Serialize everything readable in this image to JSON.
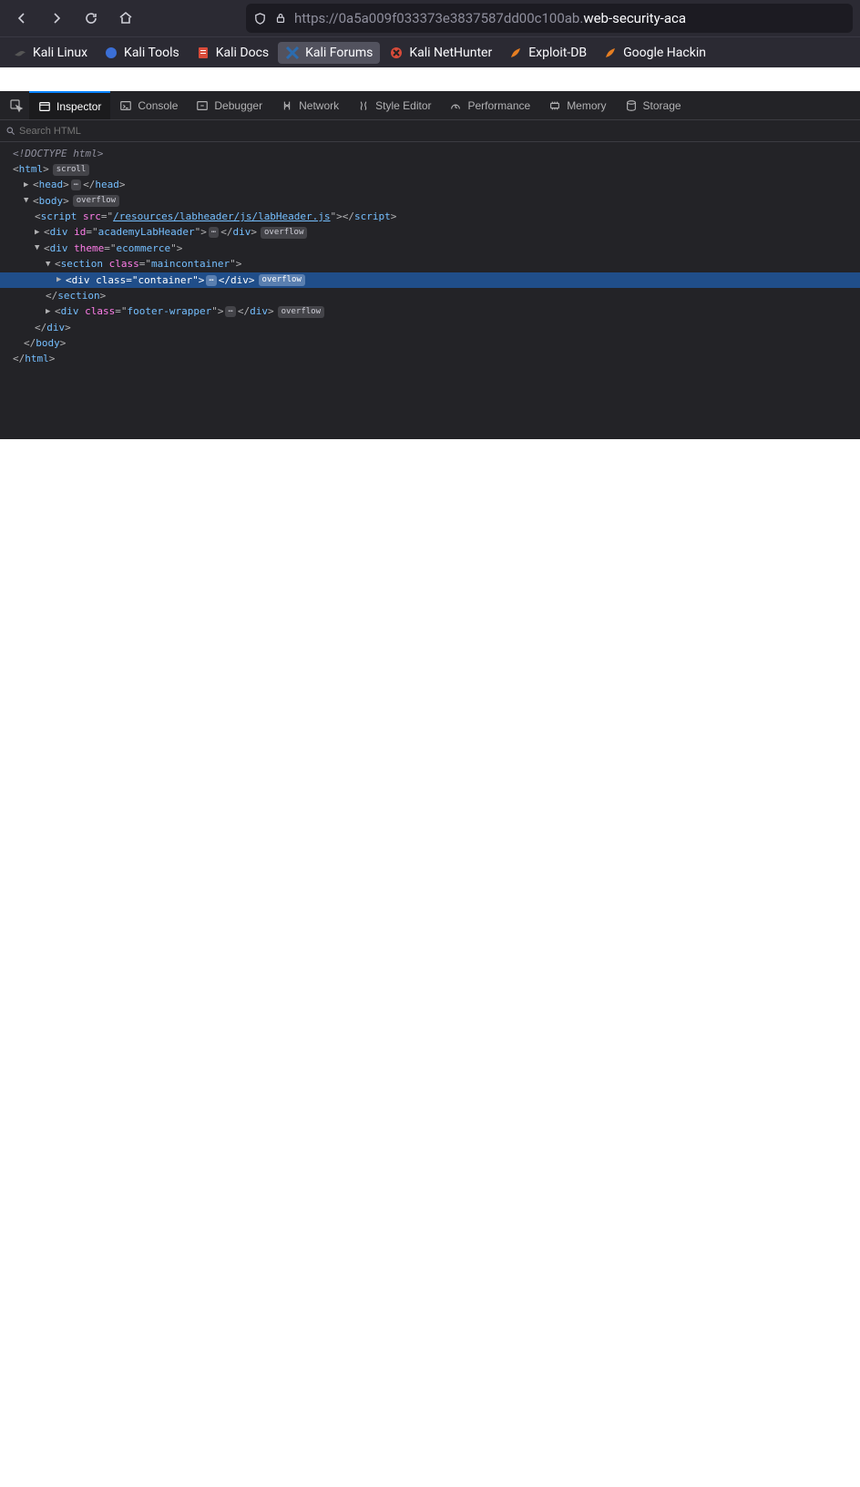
{
  "nav": {
    "url_prefix": "https://",
    "url_sub": "0a5a009f033373e3837587dd00c100ab.",
    "url_highlight": "web-security-aca"
  },
  "bookmarks": [
    {
      "label": "Kali Linux",
      "color": "#333"
    },
    {
      "label": "Kali Tools",
      "color": "#e03a3a"
    },
    {
      "label": "Kali Docs",
      "color": "#e03a3a"
    },
    {
      "label": "Kali Forums",
      "color": "#2b6cb0"
    },
    {
      "label": "Kali NetHunter",
      "color": "#d94b3a"
    },
    {
      "label": "Exploit-DB",
      "color": "#e67e22"
    },
    {
      "label": "Google Hackin",
      "color": "#e67e22"
    }
  ],
  "devtools_tabs": [
    {
      "label": "Inspector",
      "active": true
    },
    {
      "label": "Console"
    },
    {
      "label": "Debugger"
    },
    {
      "label": "Network"
    },
    {
      "label": "Style Editor"
    },
    {
      "label": "Performance"
    },
    {
      "label": "Memory"
    },
    {
      "label": "Storage"
    }
  ],
  "search_placeholder": "Search HTML",
  "dom": {
    "doctype": "<!DOCTYPE html>",
    "html_tag": "html",
    "html_badge": "scroll",
    "head_tag": "head",
    "body_tag": "body",
    "body_badge": "overflow",
    "script_tag": "script",
    "script_attr": "src",
    "script_val": "/resources/labheader/js/labHeader.js",
    "div1_tag": "div",
    "div1_attr": "id",
    "div1_val": "academyLabHeader",
    "div1_badge": "overflow",
    "div2_tag": "div",
    "div2_attr": "theme",
    "div2_val": "ecommerce",
    "section_tag": "section",
    "section_attr": "class",
    "section_val": "maincontainer",
    "container_tag": "div",
    "container_attr": "class",
    "container_val": "container",
    "container_badge": "overflow",
    "section_close": "section",
    "footer_tag": "div",
    "footer_attr": "class",
    "footer_val": "footer-wrapper",
    "footer_badge": "overflow",
    "div2_close": "div",
    "body_close": "body",
    "html_close": "html"
  }
}
